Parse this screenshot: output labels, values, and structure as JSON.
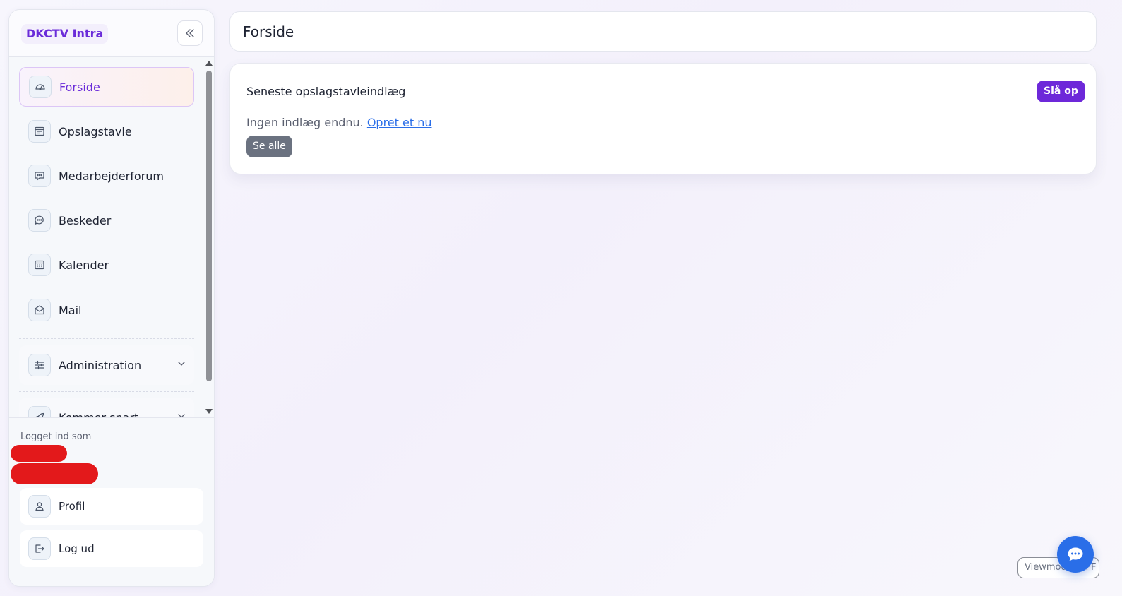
{
  "sidebar": {
    "brand": "DKCTV Intra",
    "items": [
      {
        "label": "Forside",
        "icon": "gauge-icon",
        "active": true
      },
      {
        "label": "Opslagstavle",
        "icon": "bulletin-board-icon"
      },
      {
        "label": "Medarbejderforum",
        "icon": "forum-icon"
      },
      {
        "label": "Beskeder",
        "icon": "chat-bubble-icon"
      },
      {
        "label": "Kalender",
        "icon": "calendar-icon"
      },
      {
        "label": "Mail",
        "icon": "mail-icon"
      }
    ],
    "groups": [
      {
        "label": "Administration",
        "icon": "sliders-icon"
      },
      {
        "label": "Kommer snart",
        "icon": "rocket-icon"
      }
    ],
    "footer": {
      "logged_in_label": "Logget ind som",
      "profile": "Profil",
      "logout": "Log ud"
    }
  },
  "header": {
    "title": "Forside"
  },
  "card": {
    "title": "Seneste opslagstavleindlæg",
    "post_button": "Slå op",
    "empty_text": "Ingen indlæg endnu.",
    "create_link": "Opret et nu",
    "see_all": "Se alle"
  },
  "viewmode": {
    "label": "Viewmode: OFF"
  },
  "colors": {
    "accent": "#6d28d9",
    "link": "#2a6ee8",
    "redaction": "#e3191b"
  }
}
